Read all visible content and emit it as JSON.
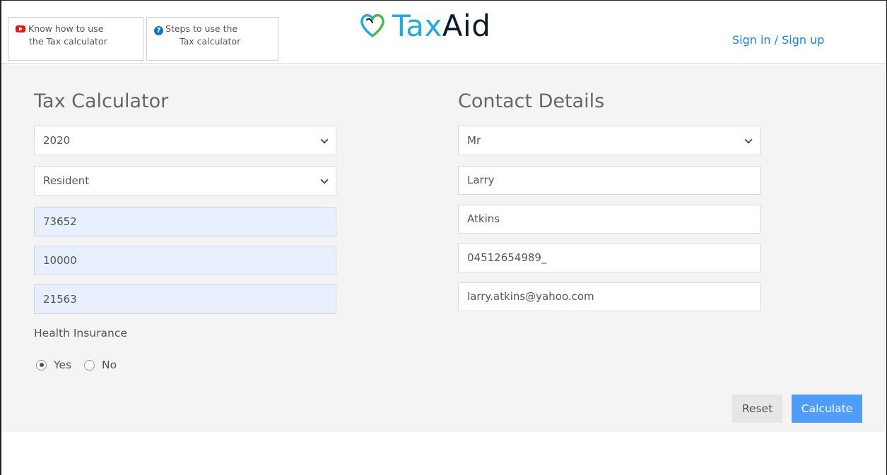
{
  "header": {
    "help_links": [
      {
        "line1": "Know how to use",
        "line2": "the Tax calculator",
        "icon": "youtube-icon"
      },
      {
        "line1": "Steps to use the",
        "line2": "Tax calculator",
        "icon": "question-circle-icon"
      }
    ],
    "logo": {
      "part1": "Tax",
      "part2": "Aid"
    },
    "sign_in": "Sign in",
    "separator": " / ",
    "sign_up": "Sign up"
  },
  "calculator": {
    "title": "Tax Calculator",
    "year": "2020",
    "residency": "Resident",
    "income_fields": [
      "73652",
      "10000",
      "21563"
    ],
    "health_insurance_label": "Health Insurance",
    "options": [
      "Yes",
      "No"
    ],
    "selected_option": "Yes"
  },
  "contact": {
    "title": "Contact Details",
    "salutation": "Mr",
    "first_name": "Larry",
    "last_name": "Atkins",
    "phone": "04512654989_",
    "email": "larry.atkins@yahoo.com"
  },
  "actions": {
    "reset": "Reset",
    "calculate": "Calculate"
  },
  "colors": {
    "accent_blue": "#4f9df8",
    "link_blue": "#1a86c8",
    "logo_tax": "#29a9d8",
    "autofill_bg": "#e8effd"
  }
}
